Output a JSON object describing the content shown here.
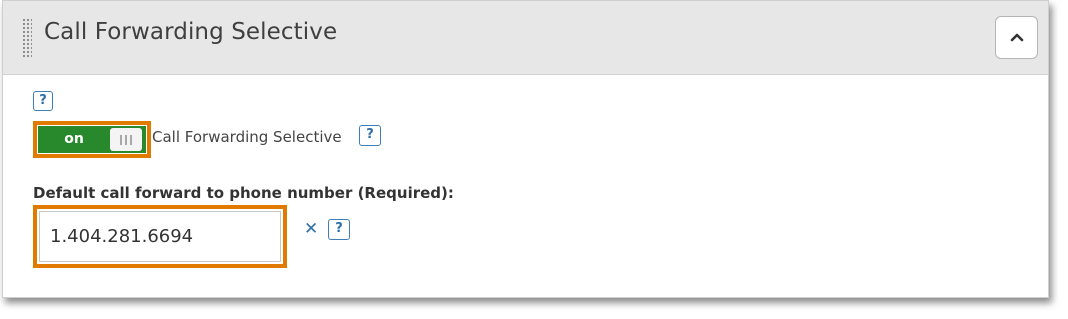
{
  "panel": {
    "title": "Call Forwarding Selective"
  },
  "help_icon_glyph": "?",
  "toggle": {
    "state_label": "on",
    "field_label": "Call Forwarding Selective",
    "on_color": "#27882c"
  },
  "forward_field": {
    "label": "Default call forward to phone number (Required):",
    "value": "1.404.281.6694",
    "clear_glyph": "✕"
  },
  "highlight_color": "#e07b00",
  "icons": [
    "drag-handle-icon",
    "chevron-up-icon",
    "help-icon",
    "clear-icon"
  ]
}
